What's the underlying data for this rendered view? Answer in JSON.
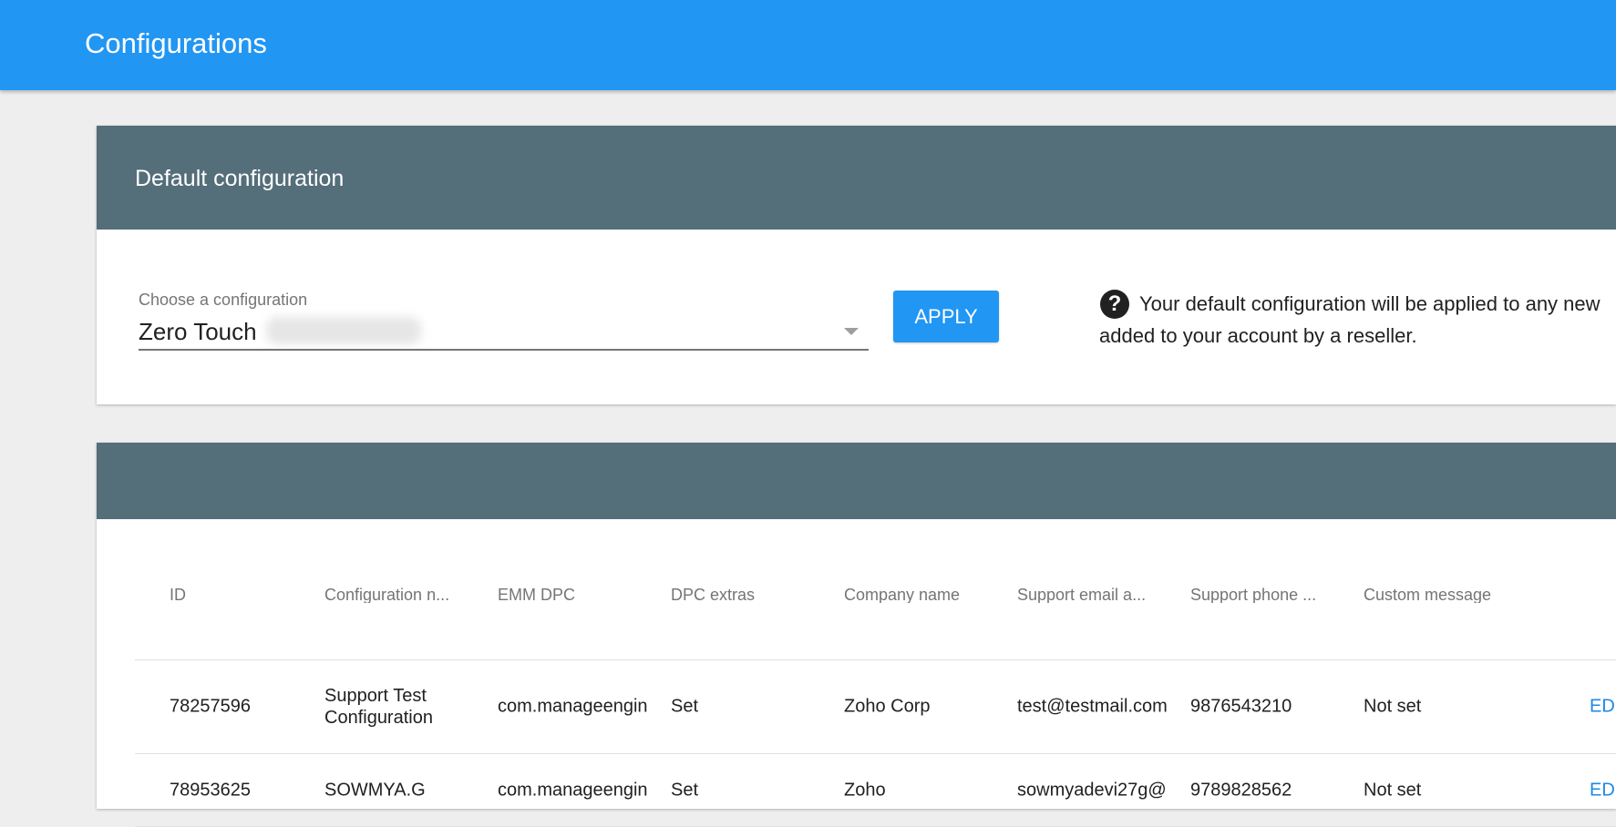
{
  "app": {
    "title": "Configurations"
  },
  "default_config": {
    "header": "Default configuration",
    "select_label": "Choose a configuration",
    "select_value": "Zero Touch",
    "apply_label": "APPLY",
    "help_line1": "Your default configuration will be applied to any new",
    "help_line2": "added to your account by a reseller."
  },
  "table": {
    "columns": [
      "ID",
      "Configuration n...",
      "EMM DPC",
      "DPC extras",
      "Company name",
      "Support email a...",
      "Support phone ...",
      "Custom message"
    ],
    "rows": [
      {
        "id": "78257596",
        "name": "Support Test Configuration",
        "emm_dpc": "com.manageengin",
        "dpc_extras": "Set",
        "company": "Zoho Corp",
        "email": "test@testmail.com",
        "phone": "9876543210",
        "message": "Not set",
        "action": "EDIT"
      },
      {
        "id": "78953625",
        "name": "SOWMYA.G",
        "emm_dpc": "com.manageengin",
        "dpc_extras": "Set",
        "company": "Zoho",
        "email": "sowmyadevi27g@",
        "phone": "9789828562",
        "message": "Not set",
        "action": "EDIT"
      }
    ]
  },
  "colors": {
    "app_bar": "#2196f3",
    "card_header": "#546e7a",
    "link": "#1e88e5",
    "background": "#eeeeee"
  }
}
